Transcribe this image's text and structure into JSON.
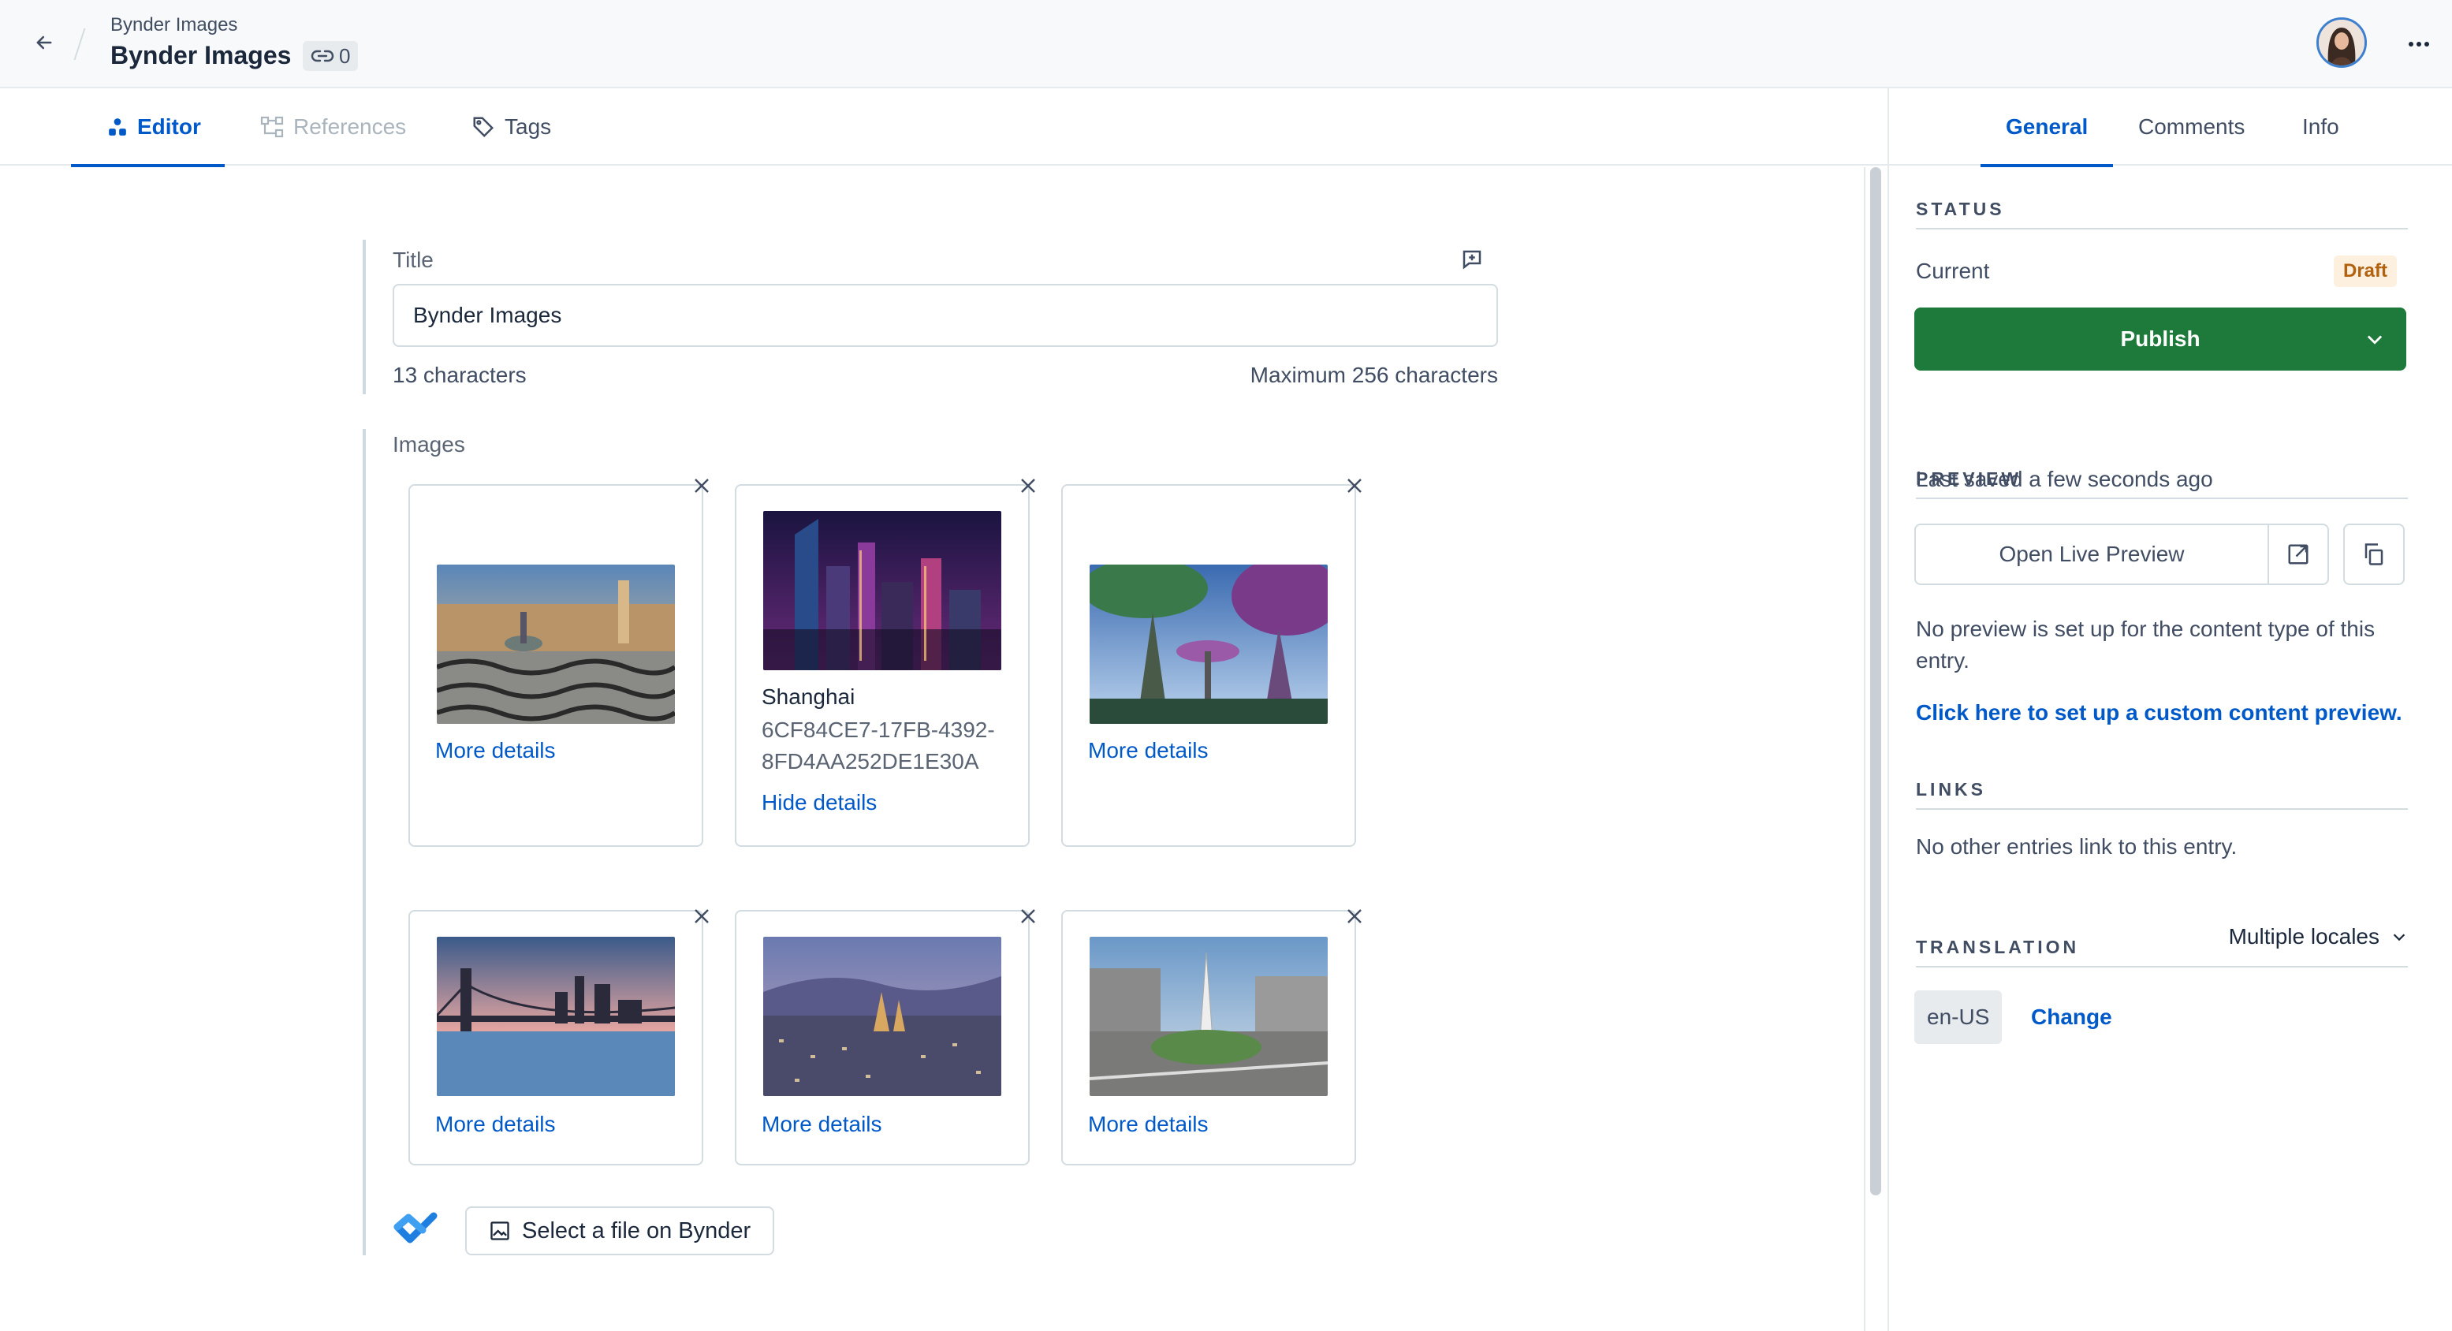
{
  "header": {
    "breadcrumb": "Bynder Images",
    "title": "Bynder Images",
    "references_count": "0"
  },
  "tabs": [
    {
      "label": "Editor",
      "state": "active"
    },
    {
      "label": "References",
      "state": "disabled"
    },
    {
      "label": "Tags",
      "state": "normal"
    }
  ],
  "sidebar": {
    "tabs": [
      "General",
      "Comments",
      "Info"
    ],
    "status": {
      "heading": "STATUS",
      "current_label": "Current",
      "badge": "Draft",
      "publish_label": "Publish",
      "last_saved": "Last saved a few seconds ago"
    },
    "preview": {
      "heading": "PREVIEW",
      "open_label": "Open Live Preview",
      "note": "No preview is set up for the content type of this entry.",
      "setup_link": "Click here to set up a custom content preview."
    },
    "links": {
      "heading": "LINKS",
      "note": "No other entries link to this entry."
    },
    "translation": {
      "heading": "TRANSLATION",
      "selector": "Multiple locales",
      "locale": "en-US",
      "change_label": "Change"
    }
  },
  "fields": {
    "title": {
      "label": "Title",
      "value": "Bynder Images",
      "char_count": "13 characters",
      "max": "Maximum 256 characters"
    },
    "images": {
      "label": "Images",
      "more_details": "More details",
      "hide_details": "Hide details",
      "expanded": {
        "name": "Shanghai",
        "id_line1": "6CF84CE7-17FB-4392-",
        "id_line2": "8FD4AA252DE1E30A"
      },
      "select_button": "Select a file on Bynder"
    }
  },
  "colors": {
    "accent": "#0059c8",
    "publish": "#1d7a3a",
    "draft_bg": "#fdf0df",
    "draft_fg": "#b2610e"
  }
}
